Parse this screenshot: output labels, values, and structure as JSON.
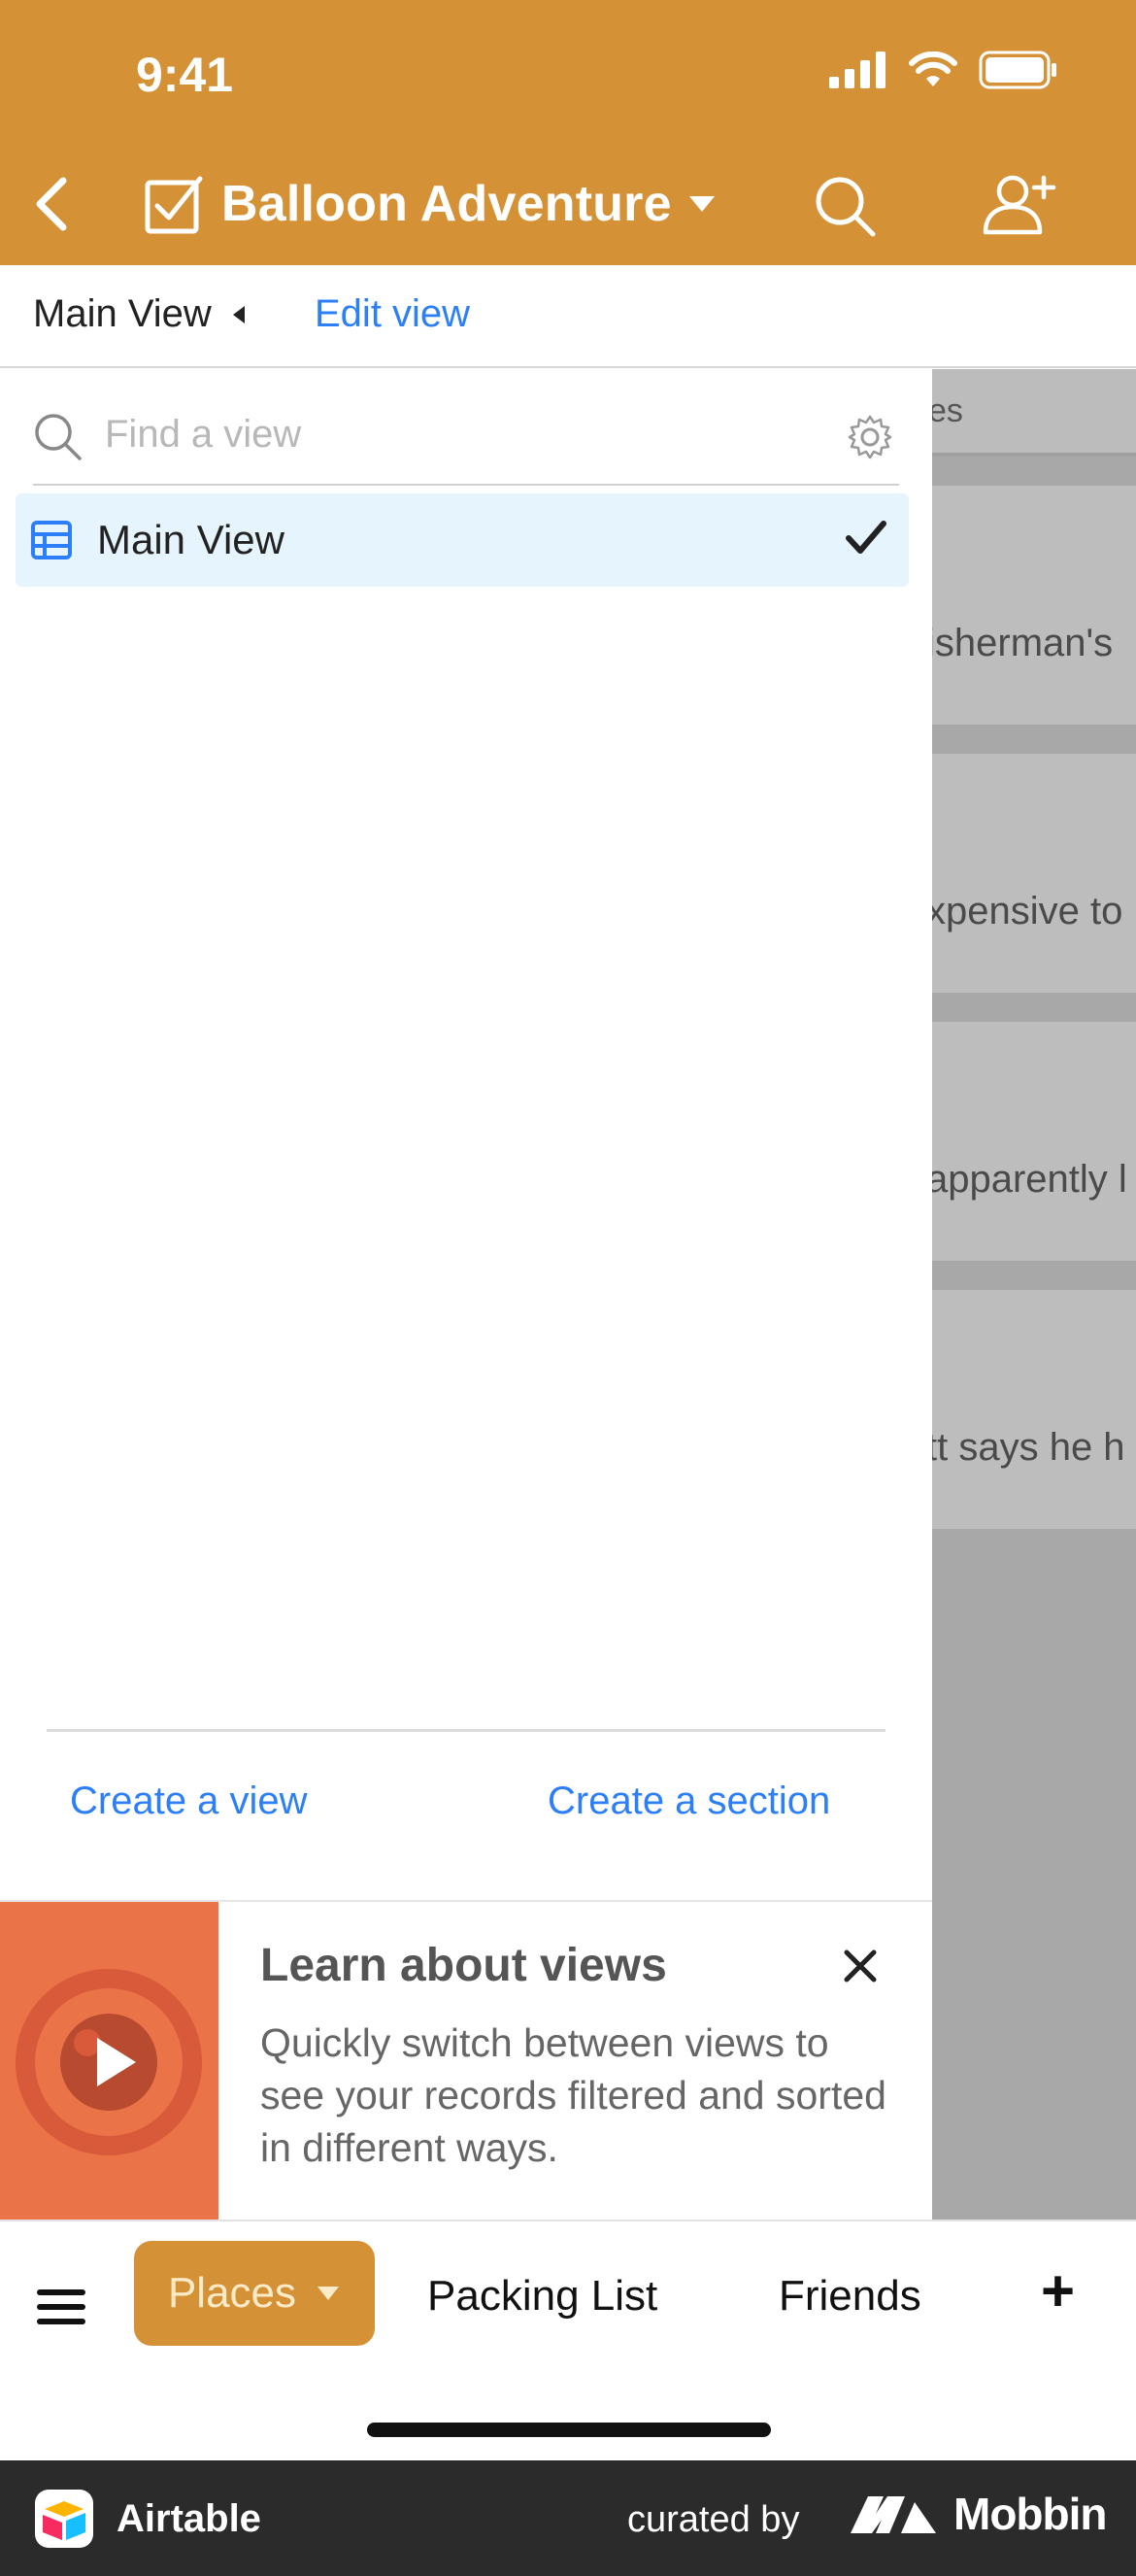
{
  "status_bar": {
    "time": "9:41"
  },
  "nav": {
    "title": "Balloon Adventure"
  },
  "view_bar": {
    "current_view": "Main View",
    "edit_label": "Edit view"
  },
  "view_panel": {
    "search_placeholder": "Find a view",
    "views": [
      {
        "label": "Main View",
        "selected": true
      }
    ],
    "create_view_label": "Create a view",
    "create_section_label": "Create a section"
  },
  "learn_banner": {
    "title": "Learn about views",
    "body": "Quickly switch between views to see your records filtered and sorted in different ways."
  },
  "background_content": {
    "column_header_fragment": "es",
    "card_fragments": [
      "isherman's",
      "xpensive to",
      "apparently l",
      "tt says he h"
    ]
  },
  "tabbar": {
    "active_tab": "Places",
    "tabs": [
      "Packing List",
      "Friends"
    ],
    "add_label": "+"
  },
  "footer": {
    "app_name": "Airtable",
    "curated_by": "curated by",
    "brand": "Mobbin"
  },
  "colors": {
    "accent": "#D59135",
    "link": "#2D7FF9",
    "selected_row": "#E6F4FE",
    "banner_thumb": "#EA7347"
  }
}
